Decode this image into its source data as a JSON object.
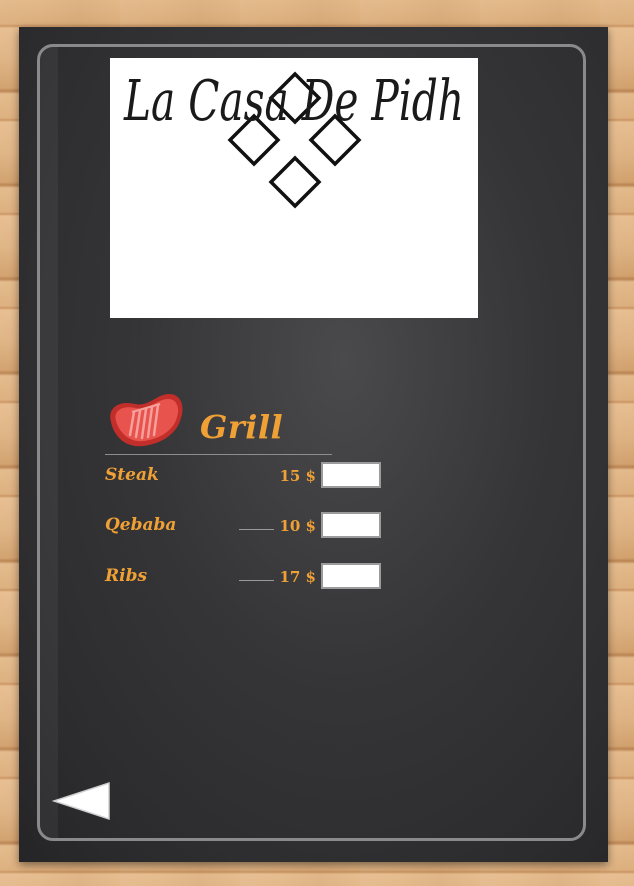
{
  "logo": {
    "name": "La Casa De Pidh"
  },
  "category": {
    "title": "Grill",
    "icon": "steak-icon"
  },
  "items": [
    {
      "name": "Steak",
      "price": "15 $",
      "qty": ""
    },
    {
      "name": "Qebaba",
      "price": "10 $",
      "qty": ""
    },
    {
      "name": "Ribs",
      "price": "17 $",
      "qty": ""
    }
  ],
  "nav": {
    "back_icon": "back-arrow-icon"
  },
  "colors": {
    "accent": "#f0a135",
    "board": "#2f2f31",
    "frame": "#8a8a8c",
    "steak": "#e0443e"
  }
}
